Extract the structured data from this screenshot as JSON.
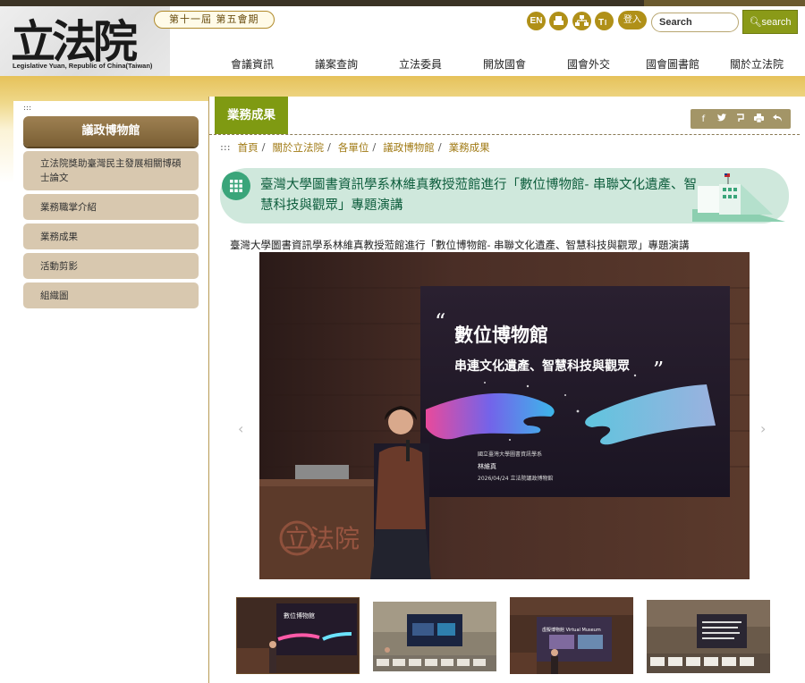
{
  "header": {
    "logo_chars": "立法院",
    "logo_en": "Legislative Yuan, Republic of China(Taiwan)",
    "session_badge": "第十一屆 第五會期",
    "utility": {
      "en": "EN",
      "sitemap_label": "",
      "login": "登入"
    },
    "search": {
      "value": "Search",
      "button": "search"
    },
    "nav": [
      "會議資訊",
      "議案查詢",
      "立法委員",
      "開放國會",
      "國會外交",
      "國會圖書館",
      "關於立法院"
    ]
  },
  "sidebar": {
    "tick": ":::",
    "title": "議政博物館",
    "items": [
      "立法院獎助臺灣民主發展相關博碩士論文",
      "業務職掌介紹",
      "業務成果",
      "活動剪影",
      "組織圖"
    ]
  },
  "content": {
    "tab": "業務成果",
    "breadcrumb": {
      "start": ":::",
      "items": [
        "首頁",
        "關於立法院",
        "各單位",
        "議政博物館",
        "業務成果"
      ],
      "sep": "/"
    },
    "page_title": "臺灣大學圖書資訊學系林維真教授蒞館進行「數位博物館-  串聯文化遺產、智慧科技與觀眾」專題演講",
    "caption": "臺灣大學圖書資訊學系林維真教授蒞館進行「數位博物館-  串聯文化遺產、智慧科技與觀眾」專題演講",
    "photo": {
      "slide_title": "數位博物館",
      "slide_subtitle": "串連文化遺產、智慧科技與觀眾",
      "slide_affiliation": "國立臺灣大學圖書資訊學系",
      "slide_speaker": "林維真",
      "slide_date_venue": "2026/04/24  立法院議政博物館",
      "wall_sign": "立法院"
    },
    "thumb_slides": [
      "數位博物館",
      "",
      "虛擬博物館 Virtual Museum",
      ""
    ]
  },
  "colors": {
    "accent_green": "#7f9a12",
    "gold": "#b09018",
    "sidebar_brown": "#8a6c40",
    "title_bg": "#cfe8dc"
  },
  "icons": {
    "share": [
      "facebook-icon",
      "twitter-icon",
      "plurk-icon",
      "print-icon",
      "back-icon"
    ]
  }
}
